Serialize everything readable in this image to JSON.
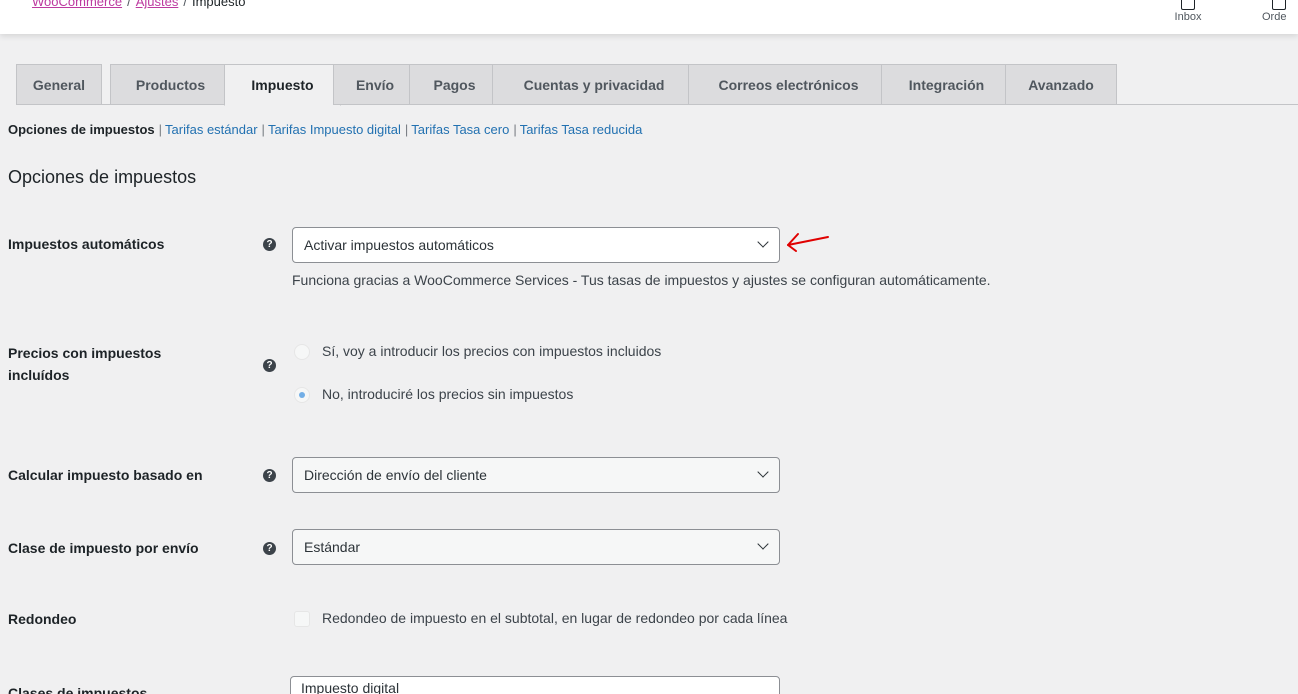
{
  "breadcrumb": {
    "woocommerce": "WooCommerce",
    "ajustes": "Ajustes",
    "current": "Impuesto",
    "separator": "/"
  },
  "top_actions": {
    "inbox": "Inbox",
    "orders": "Orde"
  },
  "tabs": [
    "General",
    "Productos",
    "Impuesto",
    "Envío",
    "Pagos",
    "Cuentas y privacidad",
    "Correos electrónicos",
    "Integración",
    "Avanzado"
  ],
  "active_tab": "Impuesto",
  "subnav": {
    "current": "Opciones de impuestos",
    "links": [
      "Tarifas estándar",
      "Tarifas Impuesto digital",
      "Tarifas Tasa cero",
      "Tarifas Tasa reducida"
    ],
    "separator": "|"
  },
  "section_title": "Opciones de impuestos",
  "fields": {
    "auto_tax": {
      "label": "Impuestos automáticos",
      "value": "Activar impuestos automáticos",
      "description": "Funciona gracias a WooCommerce Services - Tus tasas de impuestos y ajustes se configuran automáticamente."
    },
    "prices_incl": {
      "label_line1": "Precios con impuestos",
      "label_line2": "incluídos",
      "option_yes": "Sí, voy a introducir los precios con impuestos incluidos",
      "option_no": "No, introduciré los precios sin impuestos",
      "selected": "No, introduciré los precios sin impuestos"
    },
    "based_on": {
      "label": "Calcular impuesto basado en",
      "value": "Dirección de envío del cliente"
    },
    "shipping_class": {
      "label": "Clase de impuesto por envío",
      "value": "Estándar"
    },
    "rounding": {
      "label": "Redondeo",
      "option": "Redondeo de impuesto en el subtotal, en lugar de redondeo por cada línea",
      "checked": false
    },
    "tax_classes": {
      "label": "Clases de impuestos",
      "value": "Impuesto digital"
    }
  },
  "help_icon": "?",
  "colors": {
    "link": "#2271b1",
    "breadcrumb_link": "#bd3aa0",
    "annotation": "#e00000",
    "radio_checked": "#72aee6"
  }
}
